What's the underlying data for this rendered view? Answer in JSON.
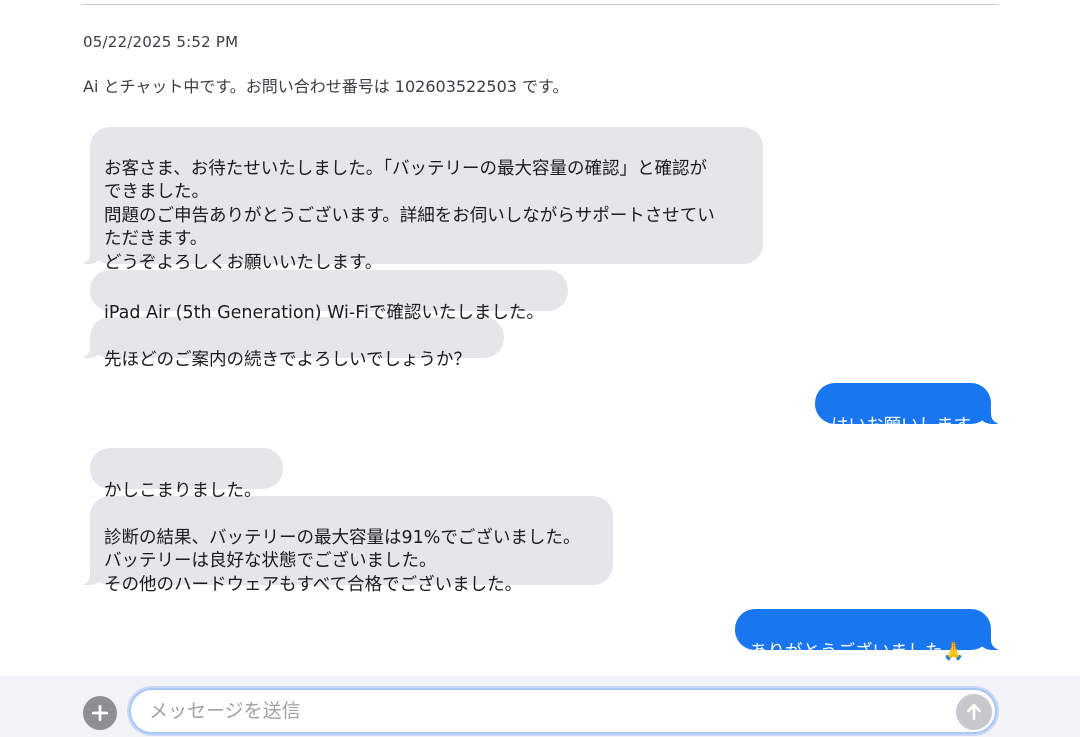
{
  "header": {
    "timestamp": "05/22/2025 5:52 PM",
    "info": "Ai とチャット中です。お問い合わせ番号は 102603522503 です。"
  },
  "messages": [
    {
      "sender": "agent",
      "text": "お客さま、お待たせいたしました。「バッテリーの最大容量の確認」と確認が\nできました。\n問題のご申告ありがとうございます。詳細をお伺いしながらサポートさせてい\nただきます。\nどうぞよろしくお願いいたします。"
    },
    {
      "sender": "agent",
      "text": "iPad Air (5th Generation) Wi-Fiで確認いたしました。"
    },
    {
      "sender": "agent",
      "text": "先ほどのご案内の続きでよろしいでしょうか？"
    },
    {
      "sender": "user",
      "text": "はいお願いします"
    },
    {
      "sender": "agent",
      "text": "かしこまりました。"
    },
    {
      "sender": "agent",
      "text": "診断の結果、バッテリーの最大容量は91%でございました。\nバッテリーは良好な状態でございました。\nその他のハードウェアもすべて合格でございました。"
    },
    {
      "sender": "user",
      "text": "ありがとうございました🙏"
    }
  ],
  "composer": {
    "placeholder": "メッセージを送信",
    "value": "",
    "plus_icon": "plus-circle-icon",
    "send_icon": "arrow-up-icon"
  },
  "colors": {
    "agent_bubble": "#e5e5ea",
    "user_bubble": "#1976f1",
    "send_button_disabled": "#c7c7cc"
  }
}
